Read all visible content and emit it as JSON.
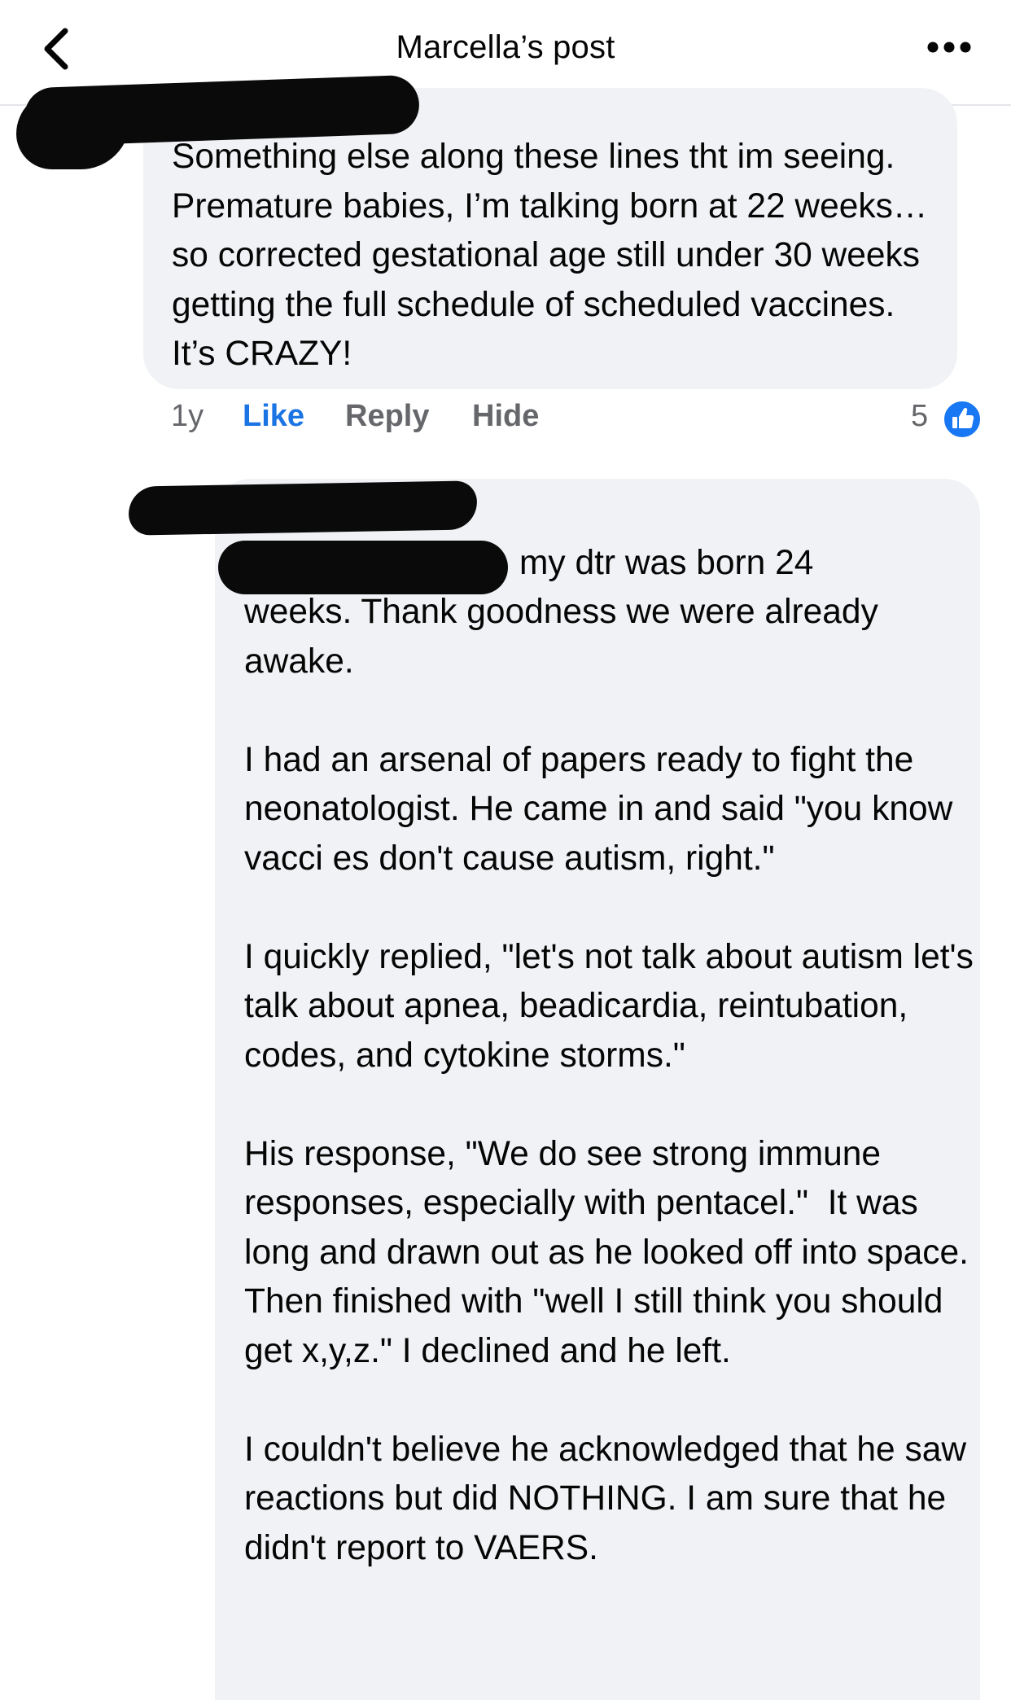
{
  "header": {
    "title": "Marcella’s post",
    "back_icon": "chevron-left-icon",
    "more_icon": "more-horizontal-icon"
  },
  "comment_1": {
    "text": "Something else along these lines tht im seeing.  Premature babies, I’m talking born at 22 weeks…so corrected gestational age still under 30 weeks getting the full schedule of scheduled vaccines.  It’s CRAZY!",
    "time": "1y",
    "like_label": "Like",
    "reply_label": "Reply",
    "hide_label": "Hide",
    "reaction_count": "5",
    "reaction_icon": "thumbs-up-icon"
  },
  "comment_2": {
    "first_line": "my dtr was born 24",
    "text": "weeks. Thank goodness we were already awake.\n\nI had an arsenal of papers ready to fight the neonatologist. He came in and said \"you know vacci es don't cause autism, right.\"\n\nI quickly replied, \"let's not talk about autism let's talk about apnea, beadicardia, reintubation, codes, and cytokine storms.\"\n\nHis response, \"We do see strong immune responses, especially with pentacel.\"  It was long and drawn out as he looked off into space. Then finished with \"well I still think you should get x,y,z.\" I declined and he left.\n\nI couldn't believe he acknowledged that he saw reactions but did NOTHING. I am sure that he didn't report to VAERS."
  },
  "colors": {
    "bubble_bg": "#f0f2f5",
    "link_blue": "#1b74e4",
    "meta_gray": "#65676b",
    "redaction": "#0a0a0a"
  }
}
